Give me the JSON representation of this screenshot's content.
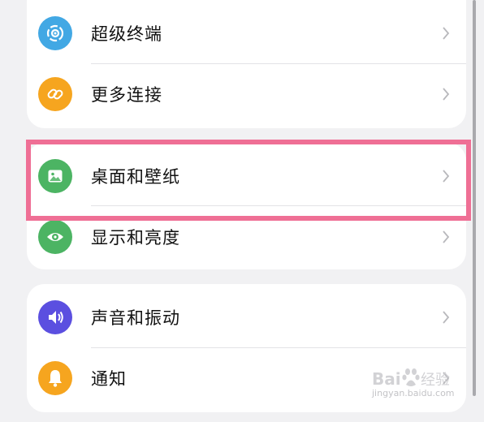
{
  "settings_groups": [
    {
      "items": [
        {
          "label": "超级终端",
          "icon": "super-device-icon",
          "icon_color": "#42a8e4"
        },
        {
          "label": "更多连接",
          "icon": "link-icon",
          "icon_color": "#f6a51f"
        }
      ]
    },
    {
      "items": [
        {
          "label": "桌面和壁纸",
          "icon": "wallpaper-icon",
          "icon_color": "#4cb463",
          "highlighted": true
        },
        {
          "label": "显示和亮度",
          "icon": "eye-icon",
          "icon_color": "#4cb463"
        }
      ]
    },
    {
      "items": [
        {
          "label": "声音和振动",
          "icon": "speaker-icon",
          "icon_color": "#5b4fe0"
        },
        {
          "label": "通知",
          "icon": "bell-icon",
          "icon_color": "#f6a51f"
        }
      ]
    }
  ],
  "highlight_color": "#ef6f95",
  "watermark": {
    "brand": "Baidu 经验",
    "url": "jingyan.baidu.com"
  }
}
